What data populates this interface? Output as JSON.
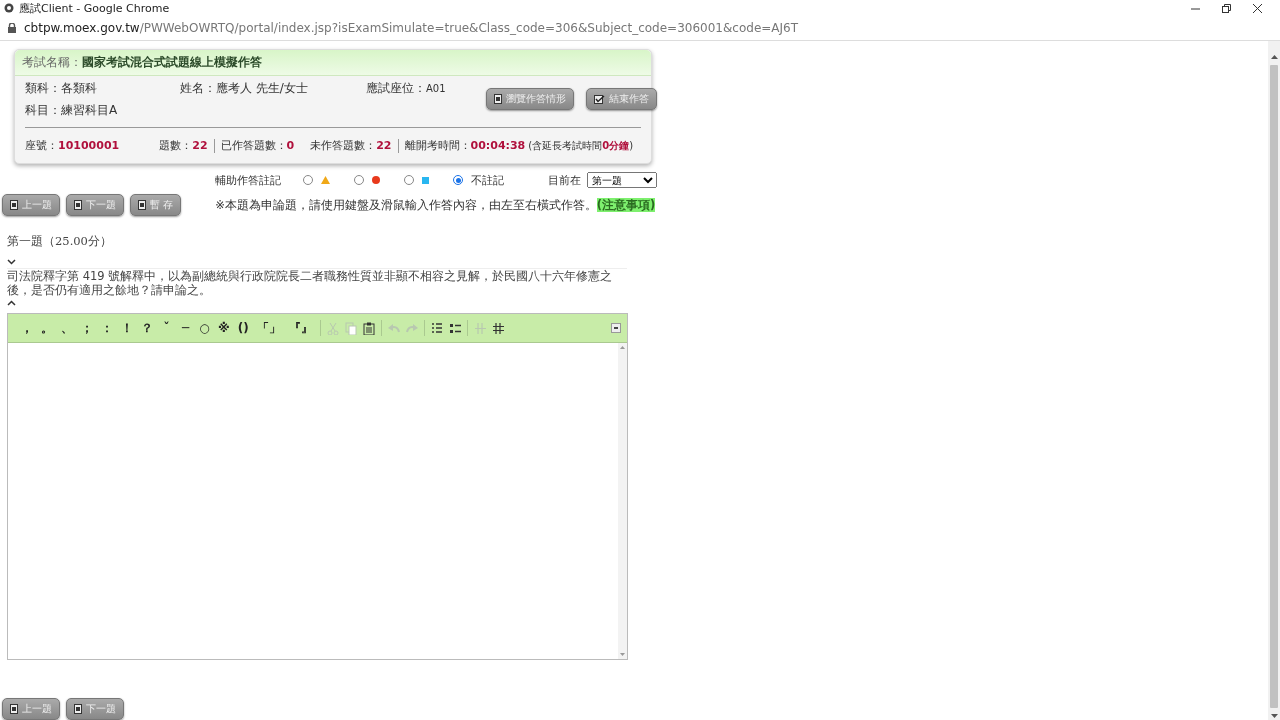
{
  "window": {
    "title": "應試Client - Google Chrome"
  },
  "address_bar": {
    "host": "cbtpw.moex.gov.tw",
    "path": "/PWWebOWRTQ/portal/index.jsp?isExamSimulate=true&Class_code=306&Subject_code=306001&code=AJ6T"
  },
  "exam": {
    "title_label": "考試名稱：",
    "title": "國家考試混合式試題線上模擬作答",
    "info": [
      {
        "label": "類科：",
        "value": "各類科"
      },
      {
        "label": "姓名：",
        "value": "應考人 先生/女士"
      },
      {
        "label": "應試座位：",
        "value": "A01"
      },
      {
        "label": "科目：",
        "value": "練習科目A"
      }
    ],
    "buttons": [
      "瀏覽作答情形",
      "結束作答"
    ],
    "stats": [
      {
        "label": "座號：",
        "value": "10100001"
      },
      {
        "label": "題數：",
        "value": "22"
      },
      {
        "label": "已作答題數：",
        "value": "0"
      },
      {
        "label": "未作答題數：",
        "value": "22"
      },
      {
        "label": "離開考時間：",
        "value": "00:04:38"
      }
    ],
    "time_note": "(含延長考試時間**0分鐘**)"
  },
  "nav_buttons": [
    "上一題",
    "下一題",
    "暫 存"
  ],
  "marks": {
    "label": "輔助作答註記",
    "options": [
      {
        "kind": "triangle",
        "color": "#f0a818",
        "selected": false
      },
      {
        "kind": "circle",
        "color": "#e8391c",
        "selected": false
      },
      {
        "kind": "square",
        "color": "#29b6f0",
        "selected": false
      },
      {
        "kind": "none",
        "label": "不註記",
        "selected": true
      }
    ]
  },
  "current": {
    "label": "目前在",
    "value": "第一題"
  },
  "instruction": {
    "text": "※本題為申論題，請使用鍵盤及滑鼠輸入作答內容，由左至右橫式作答。",
    "link": "(注意事項)"
  },
  "question": {
    "title": "第一題（25.00分）",
    "text": "司法院釋字第 419 號解釋中，以為副總統與行政院院長二者職務性質並非顯不相容之見解，於民國八十六年修憲之後，是否仍有適用之餘地？請申論之。"
  },
  "editor": {
    "symbols": [
      "，",
      "。",
      "、",
      "；",
      "：",
      "！",
      "？",
      "ˇ",
      "─",
      "○",
      "※",
      "()",
      "「」",
      "『』"
    ],
    "tools": [
      {
        "kind": "cut",
        "disabled": true
      },
      {
        "kind": "copy",
        "disabled": true
      },
      {
        "kind": "paste",
        "disabled": false
      },
      {
        "kind": "undo",
        "disabled": true
      },
      {
        "kind": "redo",
        "disabled": true
      },
      {
        "kind": "ordered-list",
        "disabled": false
      },
      {
        "kind": "bullet-list",
        "disabled": false
      },
      {
        "kind": "outdent",
        "disabled": true
      },
      {
        "kind": "indent",
        "disabled": false
      }
    ]
  },
  "bottom_nav_buttons": [
    "上一題",
    "下一題"
  ]
}
